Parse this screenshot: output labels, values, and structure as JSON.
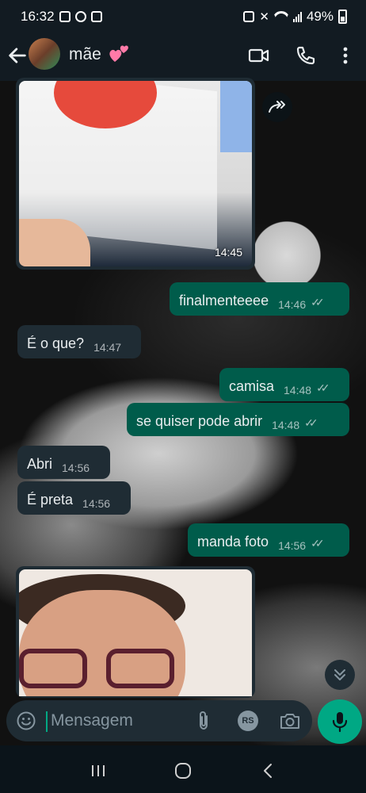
{
  "status_bar": {
    "time": "16:32",
    "battery": "49%"
  },
  "header": {
    "contact_name": "mãe"
  },
  "messages": [
    {
      "dir": "out",
      "text": "finalmenteeee",
      "time": "14:46"
    },
    {
      "dir": "in",
      "text": "É o que?",
      "time": "14:47"
    },
    {
      "dir": "out",
      "text": "camisa",
      "time": "14:48"
    },
    {
      "dir": "out",
      "text": "se quiser pode abrir",
      "time": "14:48"
    },
    {
      "dir": "in",
      "text": "Abri",
      "time": "14:56"
    },
    {
      "dir": "in",
      "text": "É preta",
      "time": "14:56"
    },
    {
      "dir": "out",
      "text": "manda foto",
      "time": "14:56"
    }
  ],
  "image_message": {
    "time": "14:45"
  },
  "input": {
    "placeholder": "Mensagem",
    "rs_badge": "RS"
  },
  "colors": {
    "outgoing": "#005c4b",
    "incoming": "#1f2c34",
    "accent": "#00a884",
    "header": "#121b22"
  }
}
